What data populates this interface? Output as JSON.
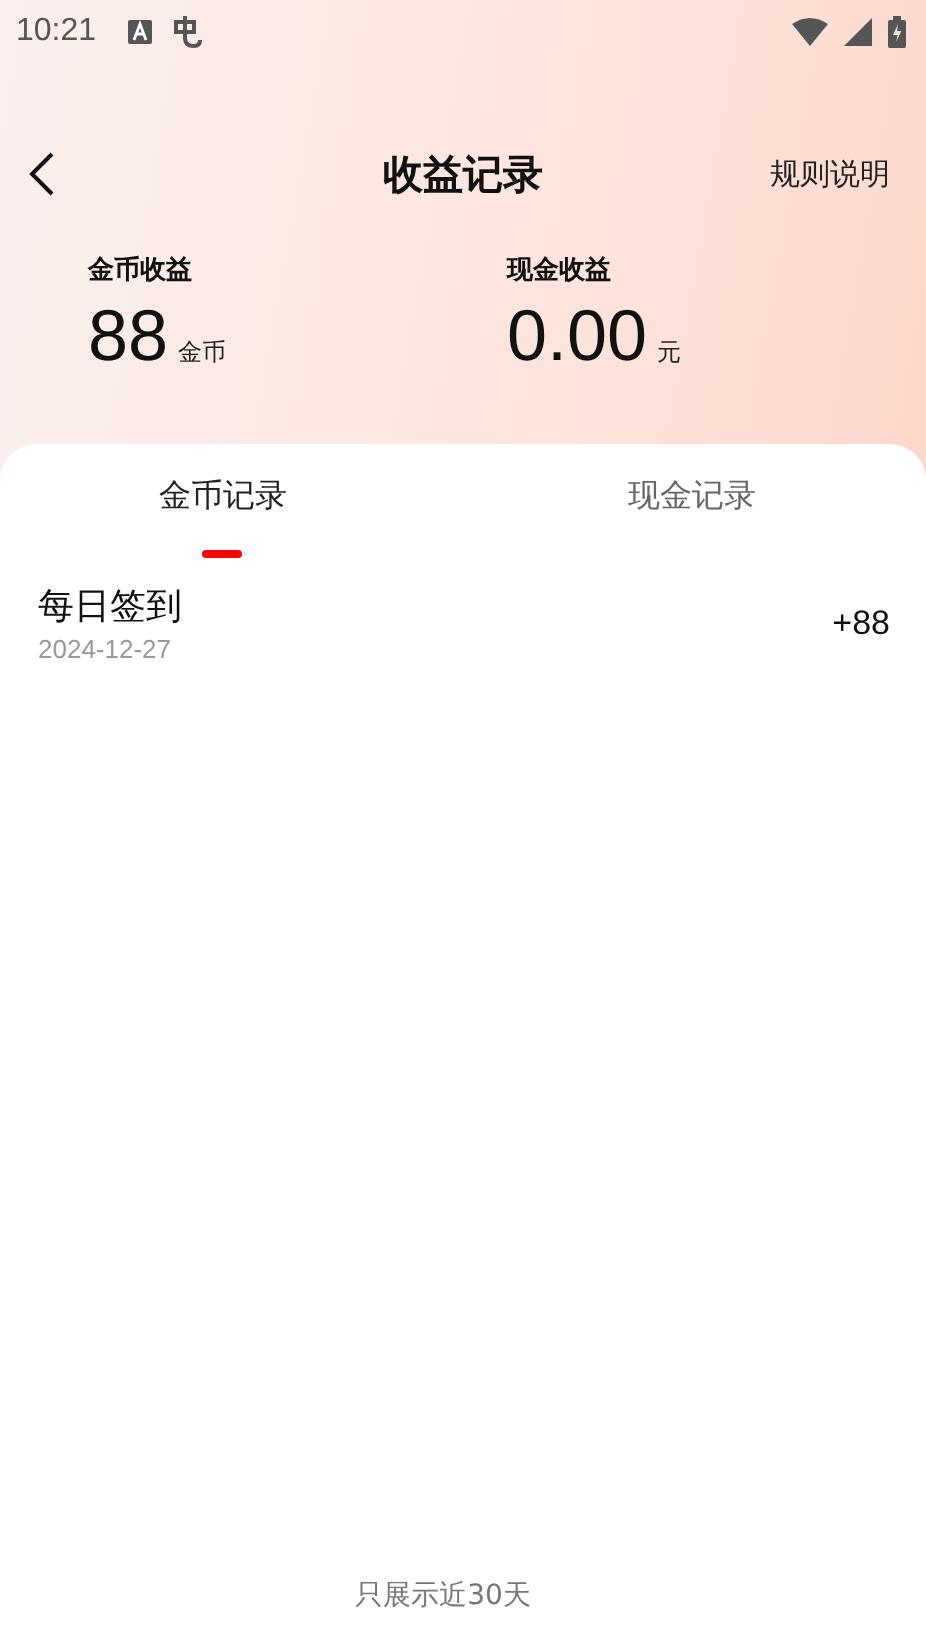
{
  "status_bar": {
    "time": "10:21"
  },
  "header": {
    "title": "收益记录",
    "action": "规则说明"
  },
  "summary": [
    {
      "label": "金币收益",
      "value": "88",
      "unit": "金币"
    },
    {
      "label": "现金收益",
      "value": "0.00",
      "unit": "元"
    }
  ],
  "tabs": [
    {
      "label": "金币记录",
      "selected": true
    },
    {
      "label": "现金记录",
      "selected": false
    }
  ],
  "records": [
    {
      "title": "每日签到",
      "date": "2024-12-27",
      "amount": "+88"
    }
  ],
  "footer_note": "只展示近30天"
}
